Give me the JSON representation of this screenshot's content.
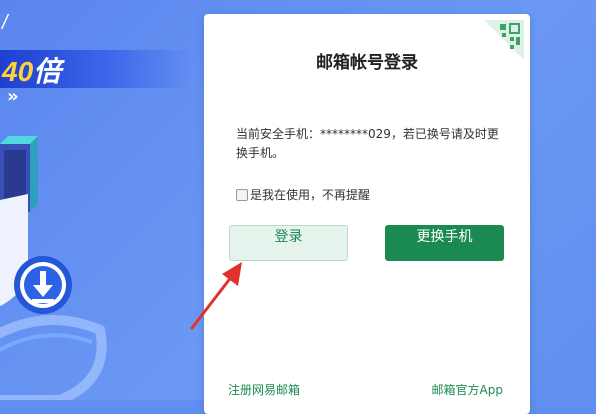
{
  "promo": {
    "slash": "/",
    "highlight": "40",
    "suffix": "倍",
    "arrows": "»"
  },
  "dialog": {
    "title": "邮箱帐号登录",
    "notice": "当前安全手机：********029，若已换号请及时更换手机。",
    "remember_label": "是我在使用，不再提醒",
    "login_button": "登录",
    "change_phone_button": "更换手机",
    "register_link": "注册网易邮箱",
    "app_link": "邮箱官方App"
  },
  "colors": {
    "brand_green": "#1a8a52",
    "background_blue": "#5f8ff0",
    "annotation_red": "#e0322c"
  },
  "icons": [
    "qr-code-icon",
    "download-icon",
    "annotation-arrow"
  ]
}
